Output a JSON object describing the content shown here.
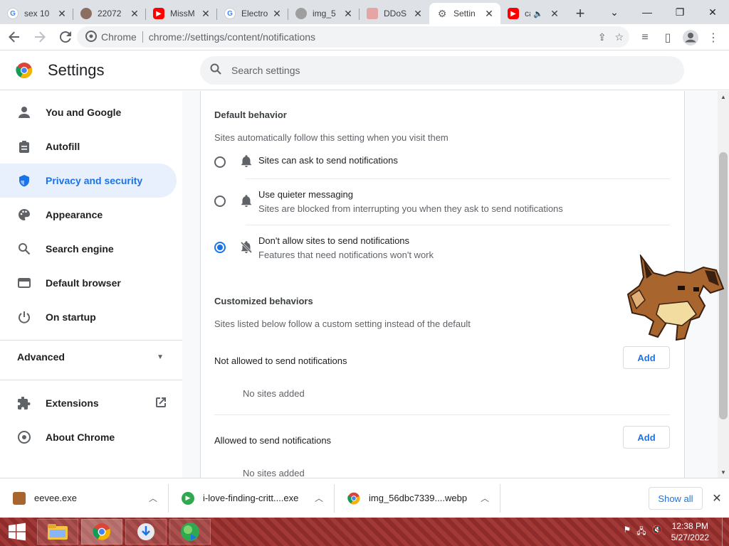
{
  "tabs": [
    {
      "label": "sex 10",
      "icon": "google-icon",
      "active": false
    },
    {
      "label": "22072",
      "icon": "web-icon",
      "active": false
    },
    {
      "label": "MissM",
      "icon": "youtube-icon",
      "active": false
    },
    {
      "label": "Electro",
      "icon": "google-icon",
      "active": false
    },
    {
      "label": "img_5",
      "icon": "web-icon",
      "active": false
    },
    {
      "label": "DDoS",
      "icon": "web-icon",
      "active": false
    },
    {
      "label": "Settin",
      "icon": "gear-icon",
      "active": true
    },
    {
      "label": "ca",
      "icon": "youtube-icon",
      "active": false
    }
  ],
  "toolbar": {
    "scheme": "Chrome",
    "url": "chrome://settings/content/notifications"
  },
  "header": {
    "title": "Settings",
    "search_placeholder": "Search settings"
  },
  "sidebar": {
    "items": [
      {
        "label": "You and Google"
      },
      {
        "label": "Autofill"
      },
      {
        "label": "Privacy and security"
      },
      {
        "label": "Appearance"
      },
      {
        "label": "Search engine"
      },
      {
        "label": "Default browser"
      },
      {
        "label": "On startup"
      }
    ],
    "advanced": "Advanced",
    "extensions": "Extensions",
    "about": "About Chrome"
  },
  "main": {
    "default_title": "Default behavior",
    "default_sub": "Sites automatically follow this setting when you visit them",
    "options": [
      {
        "label": "Sites can ask to send notifications",
        "sub": "",
        "checked": false
      },
      {
        "label": "Use quieter messaging",
        "sub": "Sites are blocked from interrupting you when they ask to send notifications",
        "checked": false
      },
      {
        "label": "Don't allow sites to send notifications",
        "sub": "Features that need notifications won't work",
        "checked": true
      }
    ],
    "custom_title": "Customized behaviors",
    "custom_sub": "Sites listed below follow a custom setting instead of the default",
    "not_allowed_label": "Not allowed to send notifications",
    "allowed_label": "Allowed to send notifications",
    "add_label": "Add",
    "no_sites": "No sites added"
  },
  "downloads": {
    "items": [
      {
        "name": "eevee.exe"
      },
      {
        "name": "i-love-finding-critt....exe"
      },
      {
        "name": "img_56dbc7339....webp"
      }
    ],
    "show_all": "Show all"
  },
  "taskbar": {
    "time": "12:38 PM",
    "date": "5/27/2022"
  },
  "colors": {
    "accent": "#1a73e8",
    "active_bg": "#e8f0fe",
    "taskbar": "#8e2b2b"
  }
}
